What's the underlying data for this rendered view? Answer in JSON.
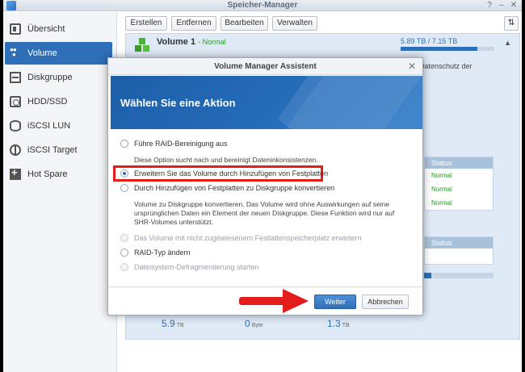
{
  "window": {
    "title": "Speicher-Manager"
  },
  "sidebar": {
    "items": [
      {
        "label": "Übersicht",
        "icon": "overview-icon"
      },
      {
        "label": "Volume",
        "icon": "volume-icon",
        "active": true
      },
      {
        "label": "Diskgruppe",
        "icon": "diskgroup-icon"
      },
      {
        "label": "HDD/SSD",
        "icon": "hdd-icon"
      },
      {
        "label": "iSCSI LUN",
        "icon": "iscsi-lun-icon"
      },
      {
        "label": "iSCSI Target",
        "icon": "iscsi-target-icon"
      },
      {
        "label": "Hot Spare",
        "icon": "hot-spare-icon"
      }
    ]
  },
  "toolbar": {
    "create": "Erstellen",
    "remove": "Entfernen",
    "edit": "Bearbeiten",
    "manage": "Verwalten"
  },
  "volume": {
    "name": "Volume 1",
    "status": "- Normal",
    "size": "5.89 TB / 7.15 TB",
    "usage_fraction": 0.82,
    "bg_text": "t Datenschutz der"
  },
  "status_tables": [
    {
      "header": "Status",
      "rows": [
        "Normal",
        "Normal",
        "Normal"
      ]
    },
    {
      "header": "Status",
      "rows": []
    }
  ],
  "small_bar_fraction": 0.1,
  "stats": [
    {
      "value": "5.9",
      "unit": "TB"
    },
    {
      "value": "0",
      "unit": "Byte"
    },
    {
      "value": "1.3",
      "unit": "TB"
    }
  ],
  "dialog": {
    "title": "Volume Manager Assistent",
    "heading": "Wählen Sie eine Aktion",
    "options": [
      {
        "label": "Führe RAID-Bereinigung aus",
        "checked": false,
        "disabled": false
      },
      {
        "label": "Erweitern Sie das Volume durch Hinzufügen von Festplatten",
        "checked": true,
        "disabled": false
      },
      {
        "label": "Durch Hinzufügen von Festplatten zu Diskgruppe konvertieren",
        "checked": false,
        "disabled": false
      },
      {
        "label": "Das Volume mit nicht zugewiesenem Festlattenspeicherplatz erweitern",
        "checked": false,
        "disabled": true
      },
      {
        "label": "RAID-Typ ändern",
        "checked": false,
        "disabled": false
      },
      {
        "label": "Dateisystem-Defragmentierung starten",
        "checked": false,
        "disabled": true
      }
    ],
    "desc_raid": "Diese Option sucht nach und bereinigt Dateninkonsistenzen.",
    "desc_convert": "Volume zu Diskgruppe konvertieren. Das Volume wird ohne Auswirkungen auf seine ursprünglichen Daten ein Element der neuen Diskgruppe. Diese Funktion wird nur auf SHR-Volumes unterstützt.",
    "next": "Weiter",
    "cancel": "Abbrechen"
  },
  "colors": {
    "accent": "#2f6fb7",
    "highlight": "#e31c1c",
    "normal": "#2a9a2a"
  }
}
